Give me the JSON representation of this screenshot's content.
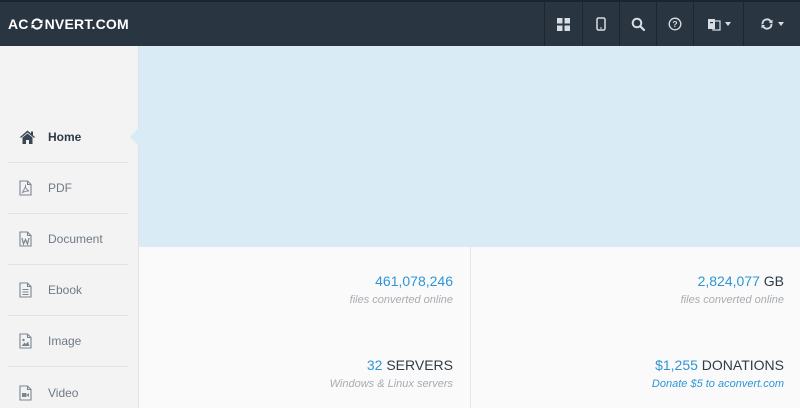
{
  "header": {
    "logo_left": "AC",
    "logo_right": "NVERT.COM"
  },
  "toolbar": {
    "buttons": [
      {
        "icon": "grid-icon"
      },
      {
        "icon": "tablet-icon"
      },
      {
        "icon": "search-icon"
      },
      {
        "icon": "help-icon"
      },
      {
        "icon": "language-icon",
        "has_caret": true
      },
      {
        "icon": "refresh-icon",
        "has_caret": true
      }
    ]
  },
  "sidebar": {
    "items": [
      {
        "label": "Home",
        "icon": "home-icon",
        "active": true
      },
      {
        "label": "PDF",
        "icon": "pdf-file-icon"
      },
      {
        "label": "Document",
        "icon": "word-document-icon"
      },
      {
        "label": "Ebook",
        "icon": "ebook-file-icon"
      },
      {
        "label": "Image",
        "icon": "image-file-icon"
      },
      {
        "label": "Video",
        "icon": "video-file-icon"
      }
    ]
  },
  "stats": {
    "files": {
      "value": "461,078,246",
      "unit": "",
      "caption": "files converted online"
    },
    "size": {
      "value": "2,824,077",
      "unit": "GB",
      "caption": "files converted online"
    },
    "servers": {
      "value": "32",
      "unit": "SERVERS",
      "caption": "Windows & Linux servers"
    },
    "donations": {
      "value": "$1,255",
      "unit": "DONATIONS",
      "caption": "Donate $5 to aconvert.com"
    }
  },
  "colors": {
    "topbar": "#2a3542",
    "hero": "#d9ecf6",
    "accent": "#2e96d6"
  }
}
